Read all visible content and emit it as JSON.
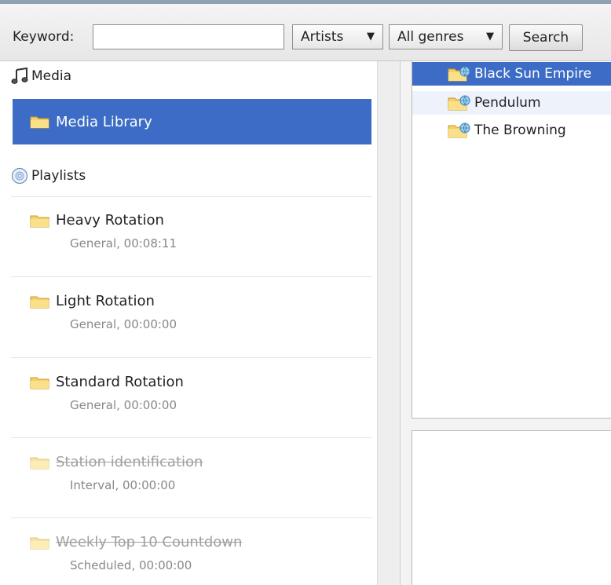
{
  "toolbar": {
    "keyword_label": "Keyword:",
    "keyword_value": "",
    "type_select": "Artists",
    "genre_select": "All genres",
    "search_button": "Search"
  },
  "sidebar": {
    "media_header": "Media",
    "media_library": "Media Library",
    "playlists_header": "Playlists",
    "playlists": [
      {
        "title": "Heavy Rotation",
        "subtitle": "General, 00:08:11",
        "disabled": false
      },
      {
        "title": "Light Rotation",
        "subtitle": "General, 00:00:00",
        "disabled": false
      },
      {
        "title": "Standard Rotation",
        "subtitle": "General, 00:00:00",
        "disabled": false
      },
      {
        "title": "Station identification",
        "subtitle": "Interval, 00:00:00",
        "disabled": true
      },
      {
        "title": "Weekly Top 10 Countdown",
        "subtitle": "Scheduled, 00:00:00",
        "disabled": true
      }
    ]
  },
  "artists": [
    {
      "name": "Black Sun Empire",
      "state": "selected"
    },
    {
      "name": "Pendulum",
      "state": "hover"
    },
    {
      "name": "The Browning",
      "state": "normal"
    }
  ],
  "colors": {
    "selection": "#3c6cc6",
    "folder": "#f0c24a",
    "muted_text": "#888888"
  },
  "icons": {
    "media": "music-note-icon",
    "library": "folder-icon",
    "playlists": "cd-icon",
    "artist": "folder-globe-icon"
  }
}
